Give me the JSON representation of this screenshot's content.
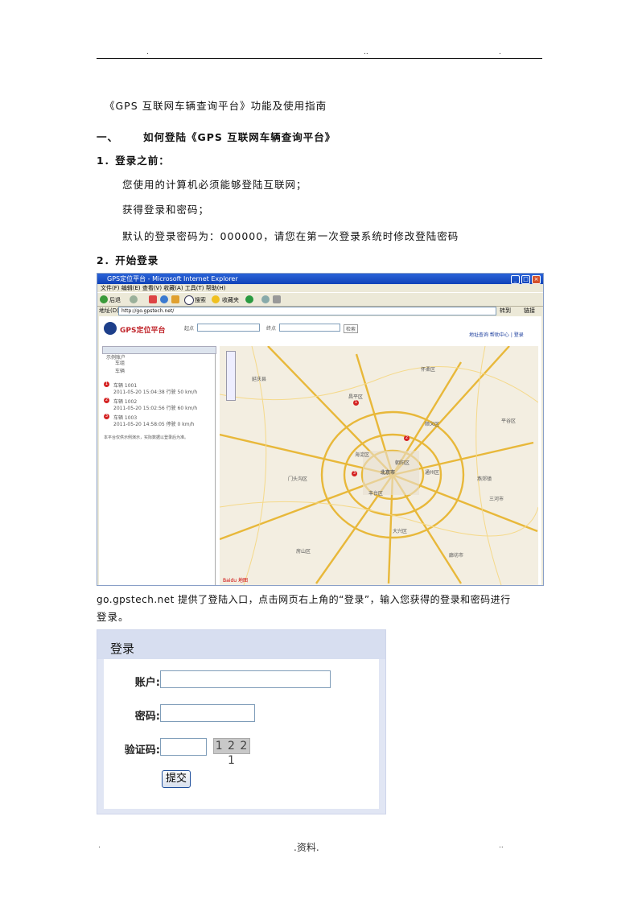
{
  "header": {
    "left_mark": ".",
    "center_mark": "..",
    "right_mark": "."
  },
  "doc_title": "《GPS 互联网车辆查询平台》功能及使用指南",
  "section1": {
    "num": "一、",
    "title": "如何登陆《GPS 互联网车辆查询平台》"
  },
  "sub1": {
    "title": "1．登录之前：",
    "items": [
      "您使用的计算机必须能够登陆互联网；",
      "获得登录和密码；",
      "默认的登录密码为：000000，请您在第一次登录系统时修改登陆密码"
    ]
  },
  "sub2": {
    "title": "2．开始登录"
  },
  "screenshot": {
    "window_title": "GPS定位平台 - Microsoft Internet Explorer",
    "menu": "文件(F)  编辑(E)  查看(V)  收藏(A)  工具(T)  帮助(H)",
    "toolbar_back": "后退",
    "toolbar_search": "搜索",
    "toolbar_fav": "收藏夹",
    "address_label": "地址(D)",
    "address_url": "http://go.gpstech.net/",
    "go_label": "转到",
    "links_label": "链接",
    "site_title": "GPS定位平台",
    "search_from_label": "起点",
    "search_to_label": "终点",
    "search_button": "检索",
    "top_links": "地址查询  帮助中心  |  登录",
    "tree_root": "示例账户",
    "tree_items": [
      "车组",
      "车辆"
    ],
    "vehicles": [
      {
        "n": "1",
        "name": "车辆 1001",
        "info": "2011-05-20 15:04:38 行驶 50 km/h"
      },
      {
        "n": "2",
        "name": "车辆 1002",
        "info": "2011-05-20 15:02:56 行驶 60 km/h"
      },
      {
        "n": "3",
        "name": "车辆 1003",
        "info": "2011-05-20 14:58:05 停驶 0 km/h"
      }
    ],
    "side_note": "本平台仅供示例演示，实际数据以登录后为准。",
    "map_labels": [
      "延庆县",
      "怀柔区",
      "昌平区",
      "顺义区",
      "平谷区",
      "海淀区",
      "朝阳区",
      "通州区",
      "丰台区",
      "门头沟区",
      "房山区",
      "大兴区",
      "北京市",
      "廊坊市",
      "燕郊镇",
      "三河市"
    ],
    "map_footer": "Baidu 地图"
  },
  "caption": {
    "line1": "go.gpstech.net 提供了登陆入口，点击网页右上角的“登录”，输入您获得的登录和密码进行",
    "line2": "登录。"
  },
  "login": {
    "title": "登录",
    "account_label": "账户:",
    "password_label": "密码:",
    "captcha_label": "验证码:",
    "captcha_text": "1 2 2 1",
    "submit_label": "提交"
  },
  "footer": {
    "left_mark": ".",
    "center_text": ".资料.",
    "right_mark": ".."
  }
}
